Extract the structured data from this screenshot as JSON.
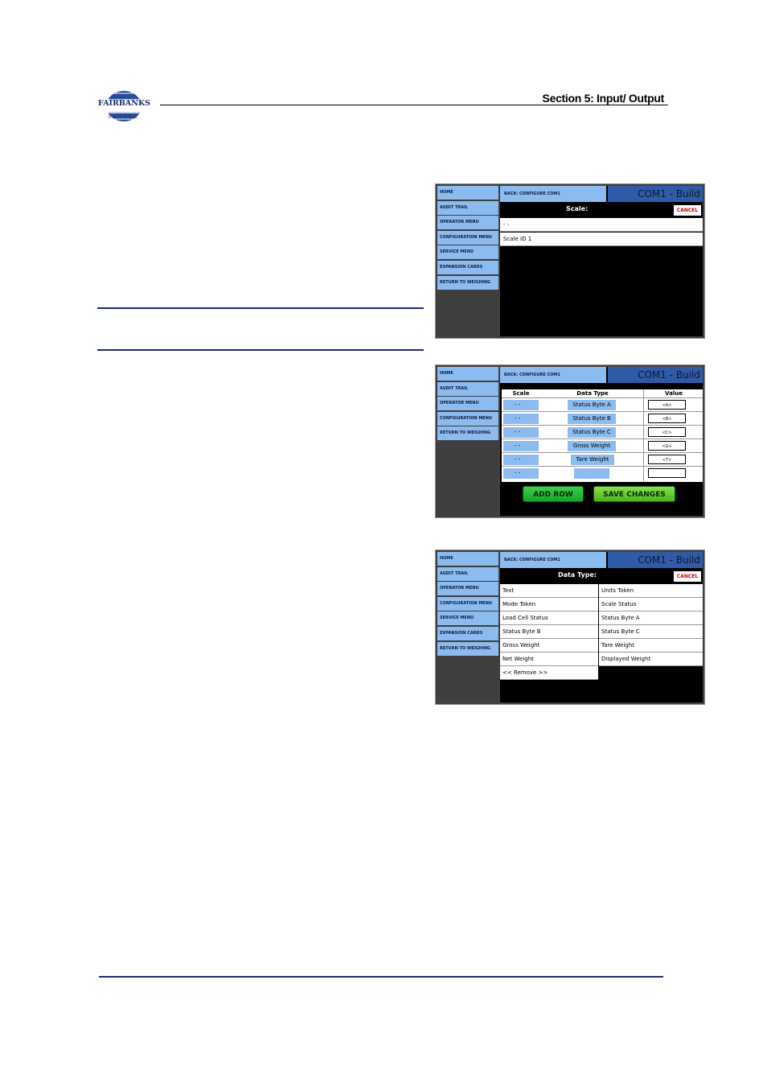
{
  "header": {
    "logo_text": "FAIRBANKS",
    "logo_sub": "SCALES",
    "section_title": "Section 5: Input/ Output"
  },
  "screen1": {
    "sidebar": [
      "HOME",
      "AUDIT TRAIL",
      "OPERATOR MENU",
      "CONFIGURATION MENU",
      "SERVICE MENU",
      "EXPANSION CARDS",
      "RETURN TO WEIGHING"
    ],
    "back_label": "BACK: CONFIGURE COM1",
    "title": "COM1 - Build",
    "bar_label": "Scale:",
    "cancel_label": "CANCEL",
    "options": [
      "- -",
      "Scale ID 1"
    ]
  },
  "screen2": {
    "sidebar": [
      "HOME",
      "AUDIT TRAIL",
      "OPERATOR MENU",
      "CONFIGURATION MENU",
      "RETURN TO WEIGHING"
    ],
    "back_label": "BACK: CONFIGURE COM1",
    "title": "COM1 - Build",
    "columns": [
      "Scale",
      "Data Type",
      "Value"
    ],
    "rows": [
      {
        "scale": "- -",
        "type": "Status Byte A",
        "value": "<A>"
      },
      {
        "scale": "- -",
        "type": "Status Byte B",
        "value": "<B>"
      },
      {
        "scale": "- -",
        "type": "Status Byte C",
        "value": "<C>"
      },
      {
        "scale": "- -",
        "type": "Gross Weight",
        "value": "<G>"
      },
      {
        "scale": "- -",
        "type": "Tare Weight",
        "value": "<T>"
      },
      {
        "scale": "- -",
        "type": "",
        "value": ""
      }
    ],
    "add_row_label": "ADD ROW",
    "save_label": "SAVE CHANGES"
  },
  "screen3": {
    "sidebar": [
      "HOME",
      "AUDIT TRAIL",
      "OPERATOR MENU",
      "CONFIGURATION MENU",
      "SERVICE MENU",
      "EXPANSION CARDS",
      "RETURN TO WEIGHING"
    ],
    "back_label": "BACK: CONFIGURE COM1",
    "title": "COM1 - Build",
    "bar_label": "Data Type:",
    "cancel_label": "CANCEL",
    "options_left": [
      "Text",
      "Mode Token",
      "Load Cell Status",
      "Status Byte B",
      "Gross Weight",
      "Net Weight",
      "<< Remove >>"
    ],
    "options_right": [
      "Units Token",
      "Scale Status",
      "Status Byte A",
      "Status Byte C",
      "Tare Weight",
      "Displayed Weight"
    ]
  }
}
